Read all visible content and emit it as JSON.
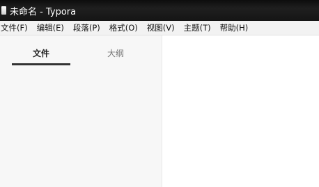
{
  "window": {
    "title": "未命名 - Typora"
  },
  "menu": {
    "items": [
      {
        "label": "文件(F)"
      },
      {
        "label": "编辑(E)"
      },
      {
        "label": "段落(P)"
      },
      {
        "label": "格式(O)"
      },
      {
        "label": "视图(V)"
      },
      {
        "label": "主题(T)"
      },
      {
        "label": "帮助(H)"
      }
    ]
  },
  "sidebar": {
    "tabs": [
      {
        "label": "文件",
        "active": true
      },
      {
        "label": "大纲",
        "active": false
      }
    ]
  },
  "colors": {
    "titlebar": "#151515",
    "menubar": "#f2f2f2",
    "sidebar": "#f7f7f7",
    "tab_active_underline": "#333333"
  },
  "icons": {
    "app": "document-icon"
  }
}
